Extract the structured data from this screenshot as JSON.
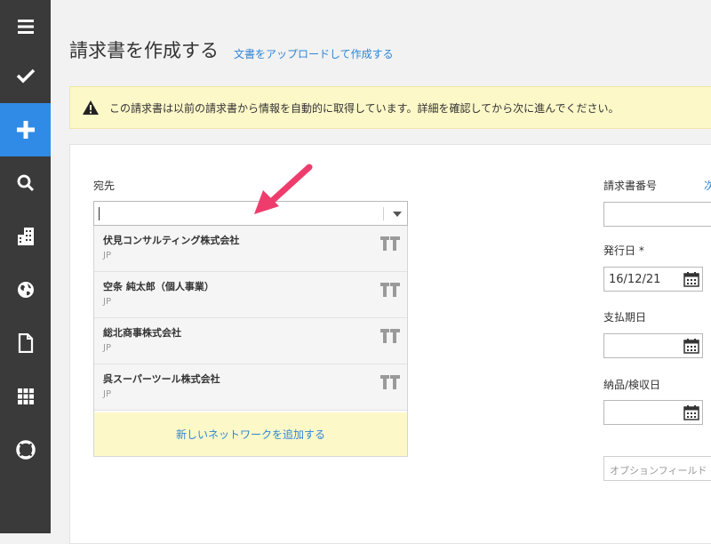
{
  "sidebar": {
    "items": [
      {
        "icon": "menu-icon"
      },
      {
        "icon": "checkmark-icon"
      },
      {
        "icon": "plus-icon",
        "active": true
      },
      {
        "icon": "search-icon"
      },
      {
        "icon": "buildings-icon"
      },
      {
        "icon": "globe-icon"
      },
      {
        "icon": "document-icon"
      },
      {
        "icon": "grid-icon"
      },
      {
        "icon": "lifebuoy-icon"
      }
    ],
    "active_color": "#2f8be6"
  },
  "header": {
    "title": "請求書を作成する",
    "link": "文書をアップロードして作成する"
  },
  "notice": {
    "icon": "warning-icon",
    "text": "この請求書は以前の請求書から情報を自動的に取得しています。詳細を確認してから次に進んでください。"
  },
  "form": {
    "to_label": "宛先",
    "to_value": "",
    "dropdown_options": [
      {
        "name": "伏見コンサルティング株式会社",
        "country": "JP"
      },
      {
        "name": "空条 純太郎（個人事業）",
        "country": "JP"
      },
      {
        "name": "総北商事株式会社",
        "country": "JP"
      },
      {
        "name": "呉スーパーツール株式会社",
        "country": "JP"
      }
    ],
    "add_network_label": "新しいネットワークを追加する",
    "invoice_number_label": "請求書番号",
    "invoice_number_link": "次",
    "invoice_number_value": "",
    "issue_date_label": "発行日 *",
    "issue_date_value": "16/12/21",
    "due_date_label": "支払期日",
    "due_date_value": "",
    "delivery_date_label": "納品/検収日",
    "delivery_date_value": "",
    "optional_field_placeholder": "オプションフィールド"
  },
  "colors": {
    "link": "#2e86d6",
    "notice_bg": "#fdf8c8",
    "arrow": "#ee3d6d"
  }
}
